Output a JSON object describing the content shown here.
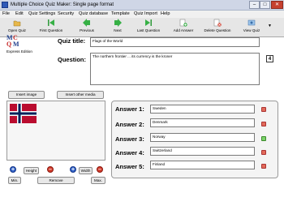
{
  "window": {
    "title": "Multiple Choice Quiz Maker: Single page format"
  },
  "menu": [
    "File",
    "Edit",
    "Quiz Settings",
    "Security",
    "Quiz database",
    "Template",
    "Quiz Import",
    "Help"
  ],
  "toolbar": {
    "open_quiz": "Open Quiz",
    "first_question": "First Question",
    "previous": "Previous",
    "next": "Next",
    "last_question": "Last Question",
    "add_answer": "Add Answer",
    "delete_question": "Delete Question",
    "view_quiz": "View Quiz"
  },
  "logo": {
    "letters": [
      "M",
      "C",
      "Q",
      "M"
    ],
    "edition": "Express Edition"
  },
  "quiz_title": {
    "label": "Quiz title:",
    "value": "Flags of the World"
  },
  "question": {
    "label": "Question:",
    "value": "The northern frontier ... its currency is the kroner",
    "number": "4"
  },
  "buttons": {
    "insert_image": "Insert image",
    "insert_other_media": "Insert other media",
    "height": "Height",
    "width": "Width",
    "min": "Min.",
    "remove": "Remove",
    "max": "Max."
  },
  "answers": [
    {
      "label": "Answer 1:",
      "value": "Sweden",
      "status": "wrong"
    },
    {
      "label": "Answer 2:",
      "value": "Denmark",
      "status": "wrong"
    },
    {
      "label": "Answer 3:",
      "value": "Norway",
      "status": "right"
    },
    {
      "label": "Answer 4:",
      "value": "Switzerland",
      "status": "wrong"
    },
    {
      "label": "Answer 5:",
      "value": "Finland",
      "status": "wrong"
    }
  ],
  "colors": {
    "flag_red": "#ba0c2f",
    "flag_blue": "#00205b",
    "correct": "#7bd16a",
    "incorrect": "#e26a5a"
  }
}
